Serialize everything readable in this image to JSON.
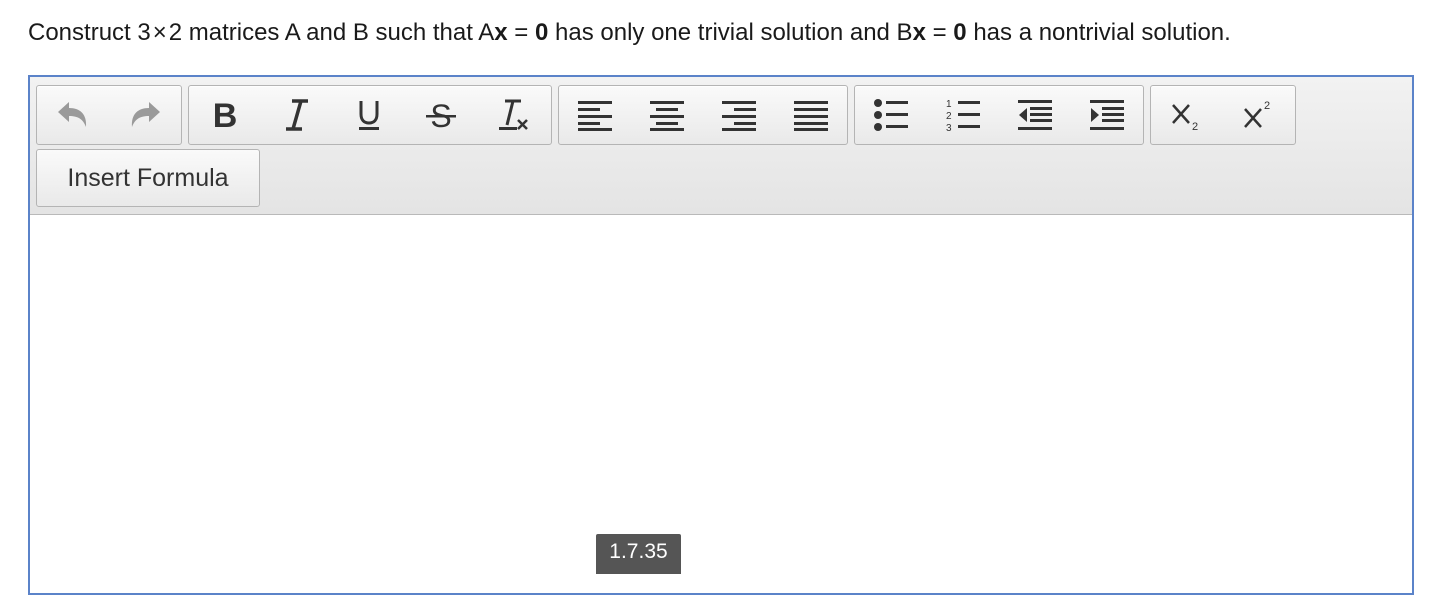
{
  "question": {
    "part1": "Construct 3",
    "times": "×",
    "part2": "2 matrices A and B such that A",
    "x1": "x",
    "eq1": "=",
    "zero1": "0",
    "part3": "has only one trivial solution and B",
    "x2": "x",
    "eq2": "=",
    "zero2": "0",
    "part4": "has a nontrivial solution."
  },
  "toolbar": {
    "history": [
      "undo-icon",
      "redo-icon"
    ],
    "format": [
      "bold-icon",
      "italic-icon",
      "underline-icon",
      "strikethrough-icon",
      "remove-format-icon"
    ],
    "align": [
      "align-left-icon",
      "align-center-icon",
      "align-right-icon",
      "align-justify-icon"
    ],
    "lists": [
      "bulleted-list-icon",
      "numbered-list-icon",
      "outdent-icon",
      "indent-icon"
    ],
    "script": [
      "subscript-icon",
      "superscript-icon"
    ],
    "insert_formula_label": "Insert Formula"
  },
  "version_label": "1.7.35",
  "colors": {
    "editor_border": "#5b83c9",
    "toolbar_bg": "#e9e9e9",
    "icon_active": "#333333",
    "icon_disabled": "#9a9a9a",
    "tooltip_bg": "#555555"
  }
}
